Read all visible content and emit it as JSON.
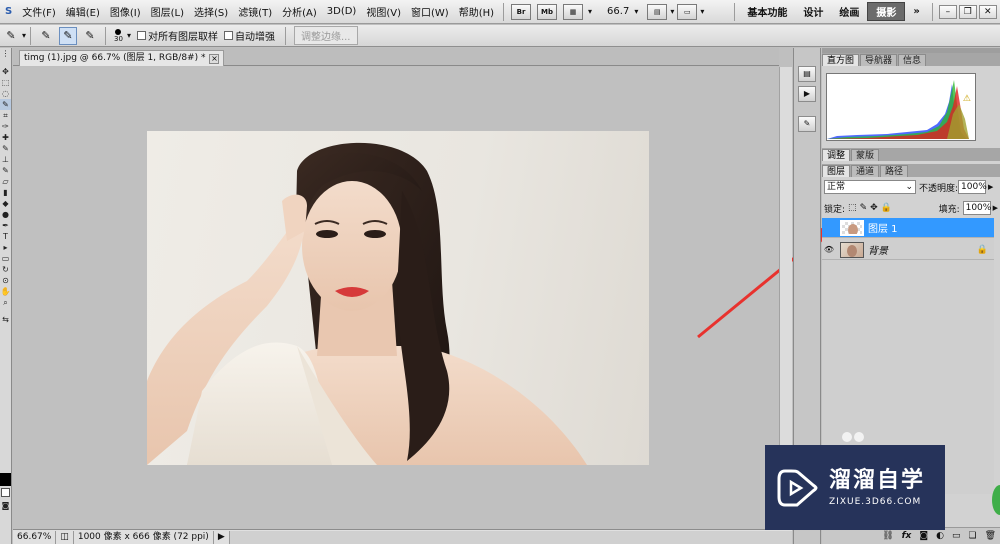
{
  "menubar": {
    "app_icon_text": "S",
    "items": [
      "文件(F)",
      "编辑(E)",
      "图像(I)",
      "图层(L)",
      "选择(S)",
      "滤镜(T)",
      "分析(A)",
      "3D(D)",
      "视图(V)",
      "窗口(W)",
      "帮助(H)"
    ],
    "icons": [
      "Br",
      "Mb"
    ],
    "zoom_value": "66.7",
    "workspaces": [
      "基本功能",
      "设计",
      "绘画"
    ],
    "workspace_active": "摄影",
    "more": "»"
  },
  "options": {
    "brush_size": "30",
    "sample_all_layers": "对所有图层取样",
    "auto_enhance": "自动增强",
    "refine_edge": "调整边缘..."
  },
  "document": {
    "tab_title": "timg (1).jpg @ 66.7% (图层 1, RGB/8#) *"
  },
  "status": {
    "zoom": "66.67%",
    "doc_info": "1000 像素 x 666 像素 (72 ppi)"
  },
  "panels": {
    "top_tabs": [
      "直方图",
      "导航器",
      "信息"
    ],
    "adjust_tabs": [
      "调整",
      "蒙版"
    ],
    "layer_tabs": [
      "图层",
      "通道",
      "路径"
    ],
    "blend_mode": "正常",
    "opacity_label": "不透明度:",
    "opacity_value": "100%",
    "lock_label": "锁定:",
    "fill_label": "填充:",
    "fill_value": "100%",
    "layers": [
      {
        "name": "图层 1",
        "selected": true,
        "visible": false,
        "locked": false
      },
      {
        "name": "背景",
        "selected": false,
        "visible": true,
        "locked": true
      }
    ],
    "bottom_icons": [
      "link-icon",
      "fx-icon",
      "mask-icon",
      "adjustment-icon",
      "group-icon",
      "new-layer-icon",
      "trash-icon"
    ]
  },
  "watermark": {
    "title": "溜溜自学",
    "subtitle": "ZIXUE.3D66.COM"
  },
  "colors": {
    "accent": "#3399ff",
    "arrow": "#e8322e",
    "watermark_bg": "#26335a"
  }
}
